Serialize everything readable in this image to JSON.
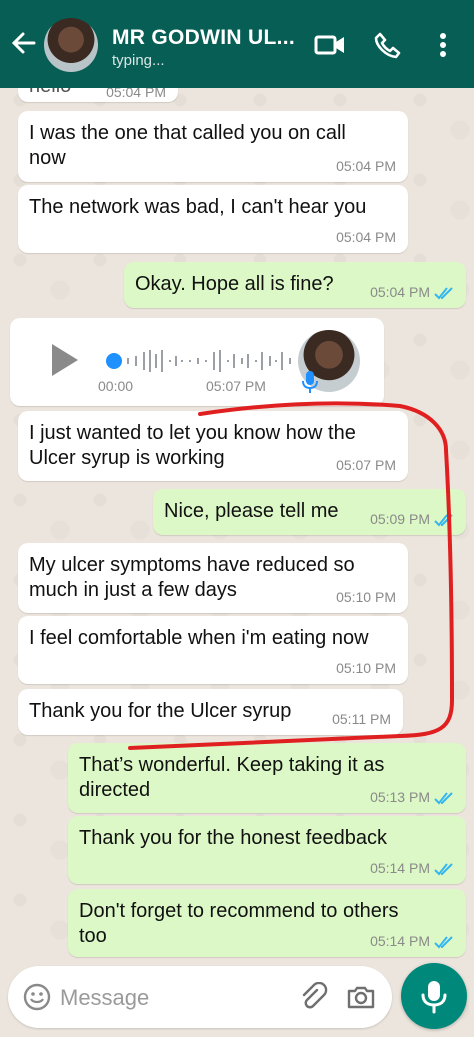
{
  "header": {
    "title": "MR GODWIN UL...",
    "status": "typing..."
  },
  "messages": [
    {
      "dir": "in",
      "text": "hello",
      "time": "05:04 PM"
    },
    {
      "dir": "in",
      "text": "I was the one that called you on call now",
      "time": "05:04 PM"
    },
    {
      "dir": "in",
      "text": "The network was bad, I can't hear you",
      "time": "05:04 PM"
    },
    {
      "dir": "out",
      "text": "Okay. Hope all is fine?",
      "time": "05:04 PM"
    },
    {
      "dir": "in",
      "type": "voice",
      "duration": "00:00",
      "time": "05:07 PM"
    },
    {
      "dir": "in",
      "text": "I just wanted to let you know how the Ulcer syrup is working",
      "time": "05:07 PM"
    },
    {
      "dir": "out",
      "text": "Nice, please tell me",
      "time": "05:09 PM"
    },
    {
      "dir": "in",
      "text": "My ulcer symptoms have reduced so much in just a few days",
      "time": "05:10 PM"
    },
    {
      "dir": "in",
      "text": "I feel comfortable when i'm eating now",
      "time": "05:10 PM"
    },
    {
      "dir": "in",
      "text": "Thank you for the Ulcer syrup",
      "time": "05:11 PM"
    },
    {
      "dir": "out",
      "text": "That’s wonderful. Keep taking it as directed",
      "time": "05:13 PM"
    },
    {
      "dir": "out",
      "text": "Thank you for the honest feedback",
      "time": "05:14 PM"
    },
    {
      "dir": "out",
      "text": "Don't forget to recommend to others too",
      "time": "05:14 PM"
    }
  ],
  "voice": {
    "left": "00:00",
    "right": "05:07 PM"
  },
  "input": {
    "placeholder": "Message"
  },
  "icons": {
    "back": "arrow-left-icon",
    "video": "video-call-icon",
    "call": "phone-icon",
    "menu": "more-vert-icon",
    "emoji": "emoji-icon",
    "attach": "paperclip-icon",
    "camera": "camera-icon",
    "mic": "mic-icon"
  },
  "colors": {
    "header": "#075e54",
    "outgoing": "#dcf8c6",
    "incoming": "#ffffff",
    "accent": "#00897b",
    "annotation": "#e02020",
    "read_tick": "#34b7f1"
  }
}
